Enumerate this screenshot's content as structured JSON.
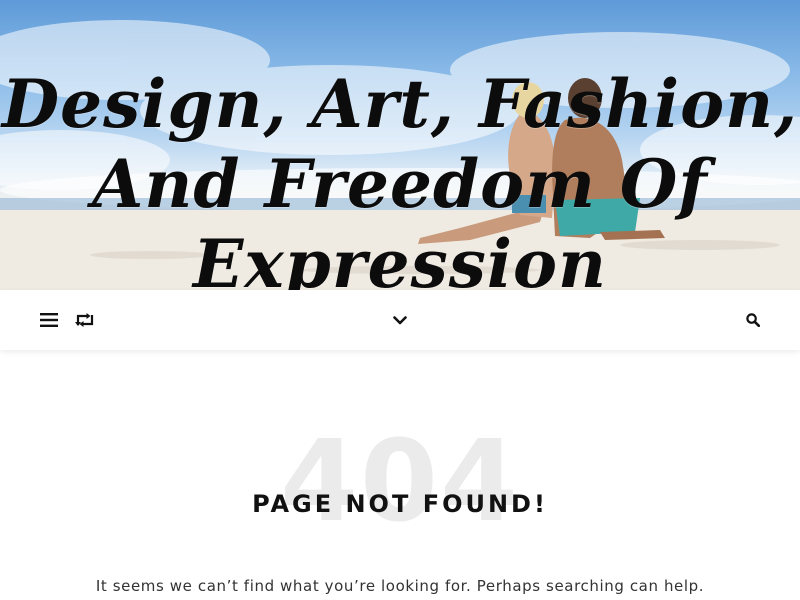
{
  "header": {
    "title_line1": "Design, Art, Fashion,",
    "title_line2": "And Freedom Of",
    "title_line3": "Expression"
  },
  "navbar": {
    "left_icons": [
      "menu-icon",
      "random-post-icon"
    ],
    "center_icon": "chevron-down-icon",
    "right_icon": "search-icon"
  },
  "error": {
    "code": "404",
    "title": "PAGE NOT FOUND!",
    "description": "It seems we can’t find what you’re looking for. Perhaps searching can help."
  },
  "colors": {
    "icon": "#111111",
    "code_watermark": "#ebebeb",
    "title_text": "#111111",
    "body_text": "#333333"
  }
}
